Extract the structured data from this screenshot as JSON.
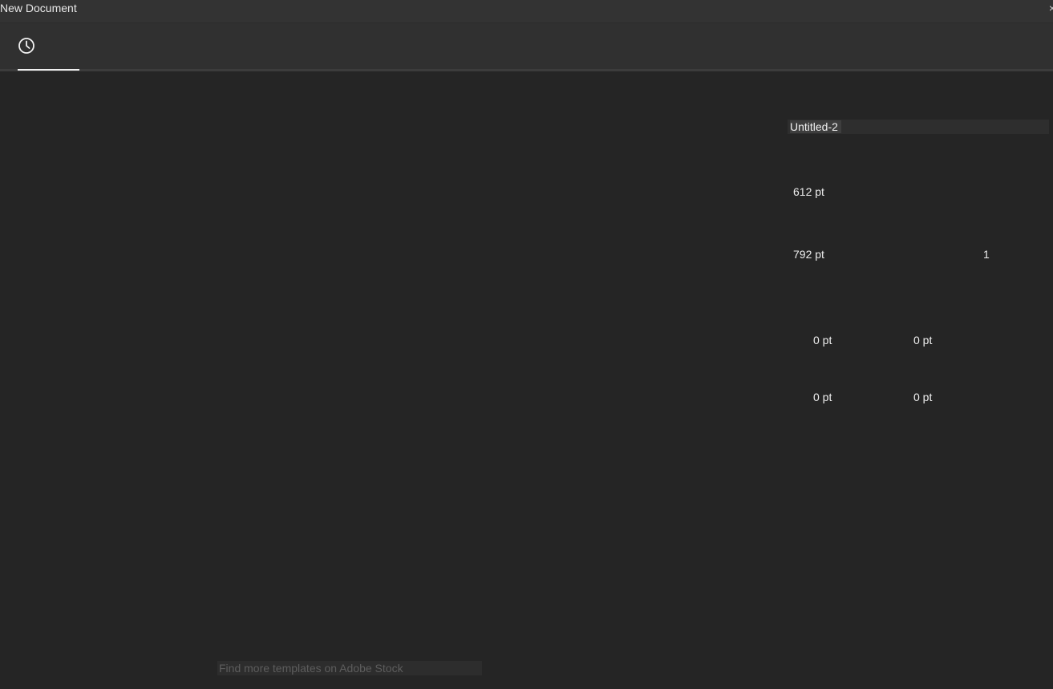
{
  "window": {
    "title": "New Document",
    "close_glyph": "×"
  },
  "tabs": [
    {
      "icon": "clock-icon",
      "label": "",
      "selected": true
    }
  ],
  "preset_details": {
    "name": "Untitled-2",
    "width": "612 pt",
    "height": "792 pt",
    "artboards": "1",
    "bleed": {
      "top": "0 pt",
      "bottom": "0 pt",
      "left": "0 pt",
      "right": "0 pt"
    }
  },
  "footer": {
    "stock_link": "Find more templates on Adobe Stock"
  },
  "colors": {
    "background": "#252525",
    "titlebar": "#333333",
    "tabbar": "#303030",
    "accent_underline": "#f0f0f0"
  }
}
